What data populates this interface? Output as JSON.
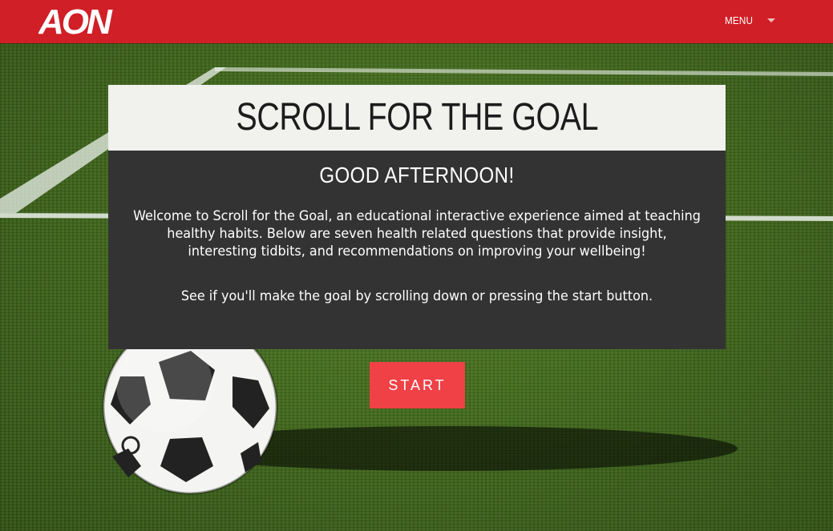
{
  "header": {
    "logo_text": "AON",
    "menu_label": "MENU",
    "brand_color": "#d01f26"
  },
  "card": {
    "title": "SCROLL FOR THE GOAL",
    "greeting": "GOOD AFTERNOON!",
    "intro": "Welcome to Scroll for the Goal, an educational interactive experience aimed at teaching healthy habits. Below are seven health related questions that provide insight, interesting tidbits, and recommendations on improving your wellbeing!",
    "cta_note": "See if you'll make the goal by scrolling down or pressing the start button."
  },
  "start_button": {
    "label": "START",
    "color": "#ef4146"
  },
  "icons": {
    "menu": "chevron-down-icon",
    "hero": "soccer-ball-image"
  }
}
